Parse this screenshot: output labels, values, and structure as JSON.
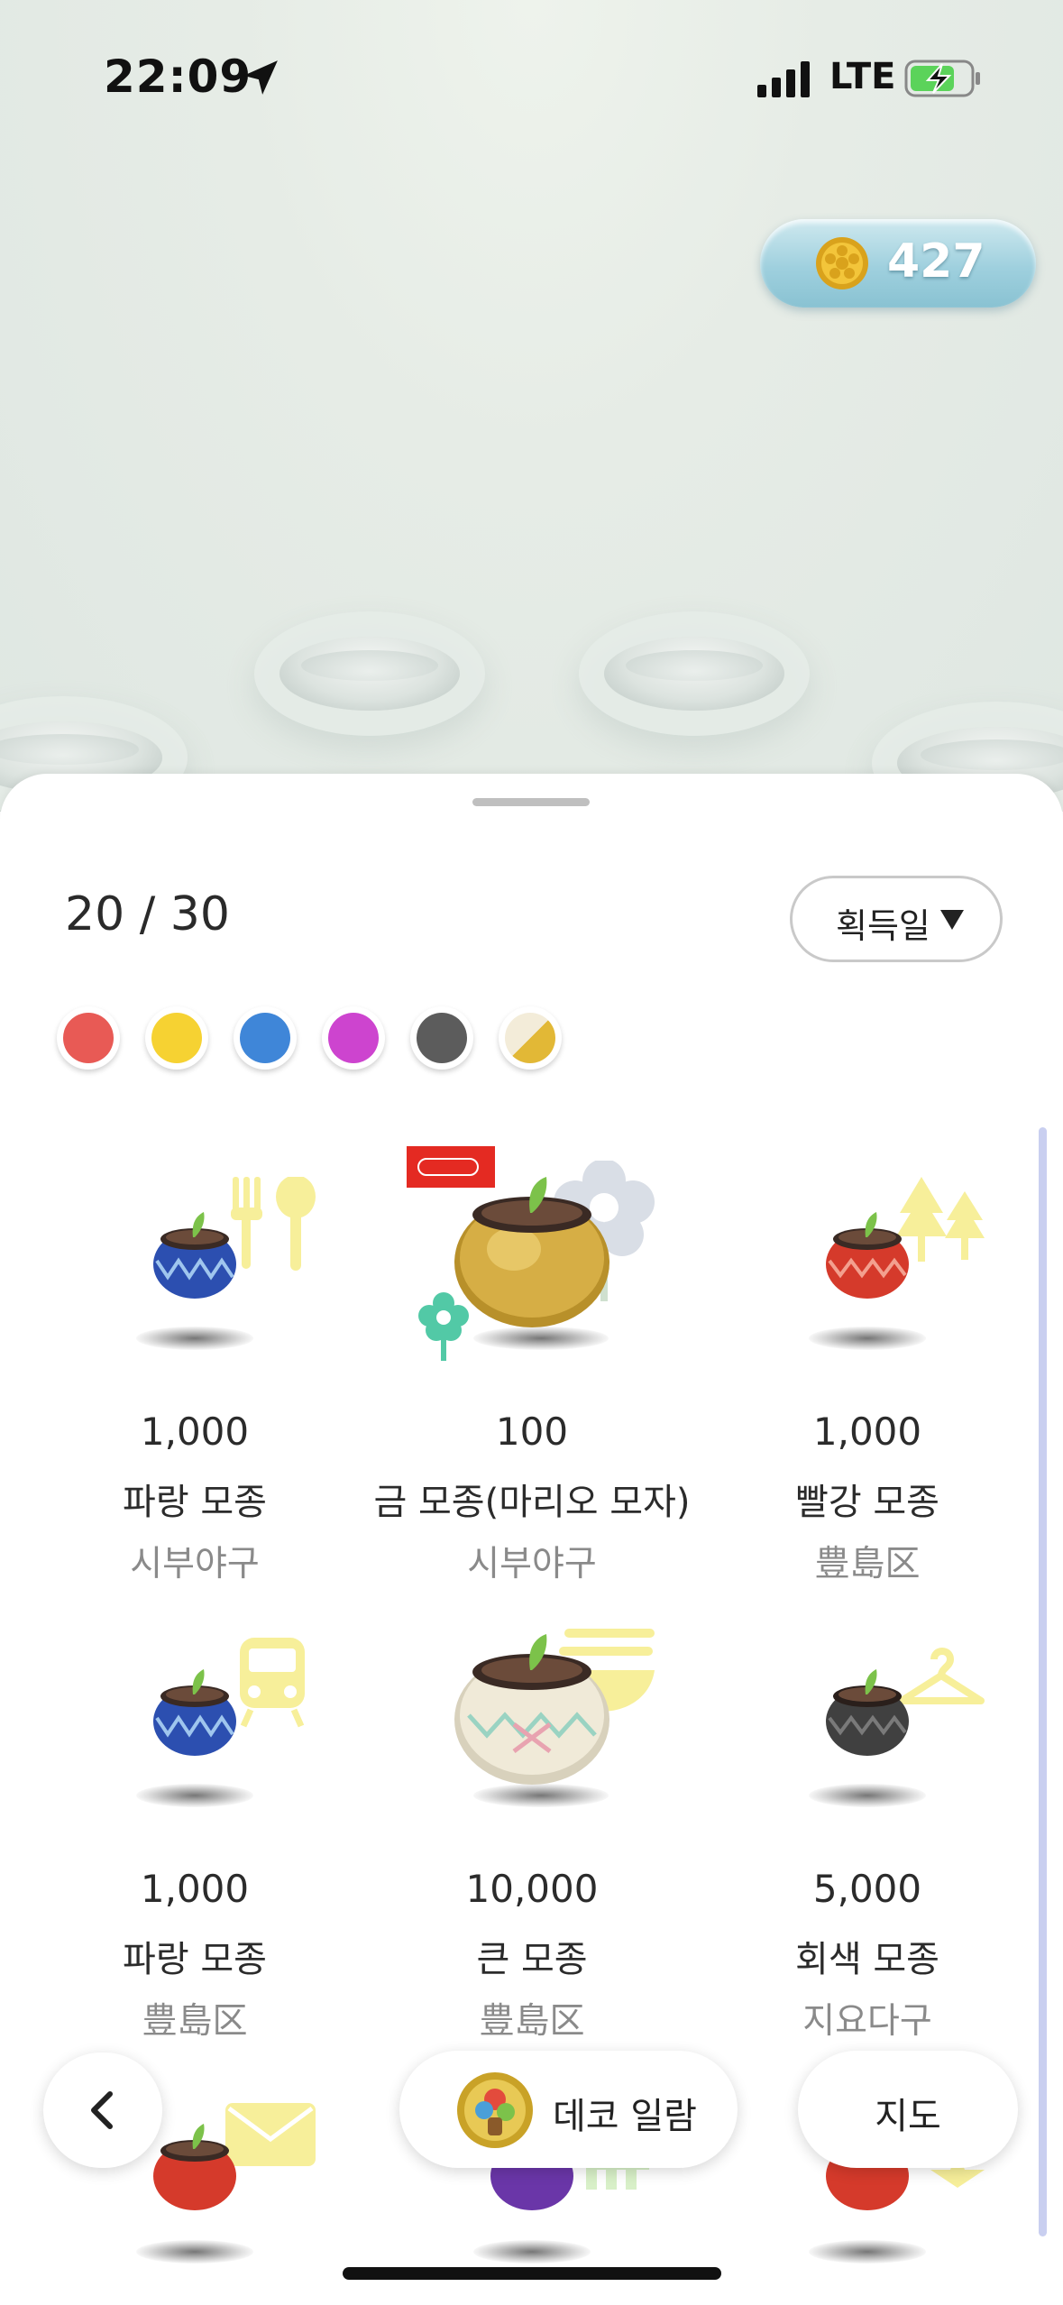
{
  "status_bar": {
    "time": "22:09",
    "network": "LTE",
    "icons": [
      "location-arrow-icon",
      "signal-bars-icon",
      "battery-charging-icon"
    ]
  },
  "wallet": {
    "coins": "427",
    "icon": "coin-icon"
  },
  "collection": {
    "count": "20 / 30",
    "sort_label": "획득일",
    "color_filters": [
      {
        "name": "red",
        "color": "#e85a55"
      },
      {
        "name": "yellow",
        "color": "#f6d232"
      },
      {
        "name": "blue",
        "color": "#3f86d8"
      },
      {
        "name": "purple",
        "color": "#cd44cf"
      },
      {
        "name": "gray",
        "color": "#5c5c5c"
      },
      {
        "name": "gold-white",
        "color": "#e2b836"
      }
    ]
  },
  "items": [
    {
      "price": "1,000",
      "name": "파랑 모종",
      "place": "시부야구",
      "pot": "blue",
      "deco": "fork-spoon-icon"
    },
    {
      "price": "100",
      "name": "금 모종(마리오 모자)",
      "place": "시부야구",
      "pot": "gold",
      "deco": "flower-icon",
      "badge": "Nintendo"
    },
    {
      "price": "1,000",
      "name": "빨강 모종",
      "place": "豊島区",
      "pot": "red",
      "deco": "trees-icon"
    },
    {
      "price": "1,000",
      "name": "파랑 모종",
      "place": "豊島区",
      "pot": "blue",
      "deco": "train-icon"
    },
    {
      "price": "10,000",
      "name": "큰 모종",
      "place": "豊島区",
      "pot": "big",
      "deco": "noodles-icon"
    },
    {
      "price": "5,000",
      "name": "회색 모종",
      "place": "지요다구",
      "pot": "gray",
      "deco": "hanger-icon"
    },
    {
      "pot": "red",
      "deco": "envelope-icon"
    },
    {
      "pot": "purple",
      "deco": "fence-icon"
    },
    {
      "pot": "red",
      "deco": "star-icon"
    }
  ],
  "bottom_nav": {
    "back_icon": "chevron-left-icon",
    "deco_label": "데코 일람",
    "map_label": "지도"
  }
}
